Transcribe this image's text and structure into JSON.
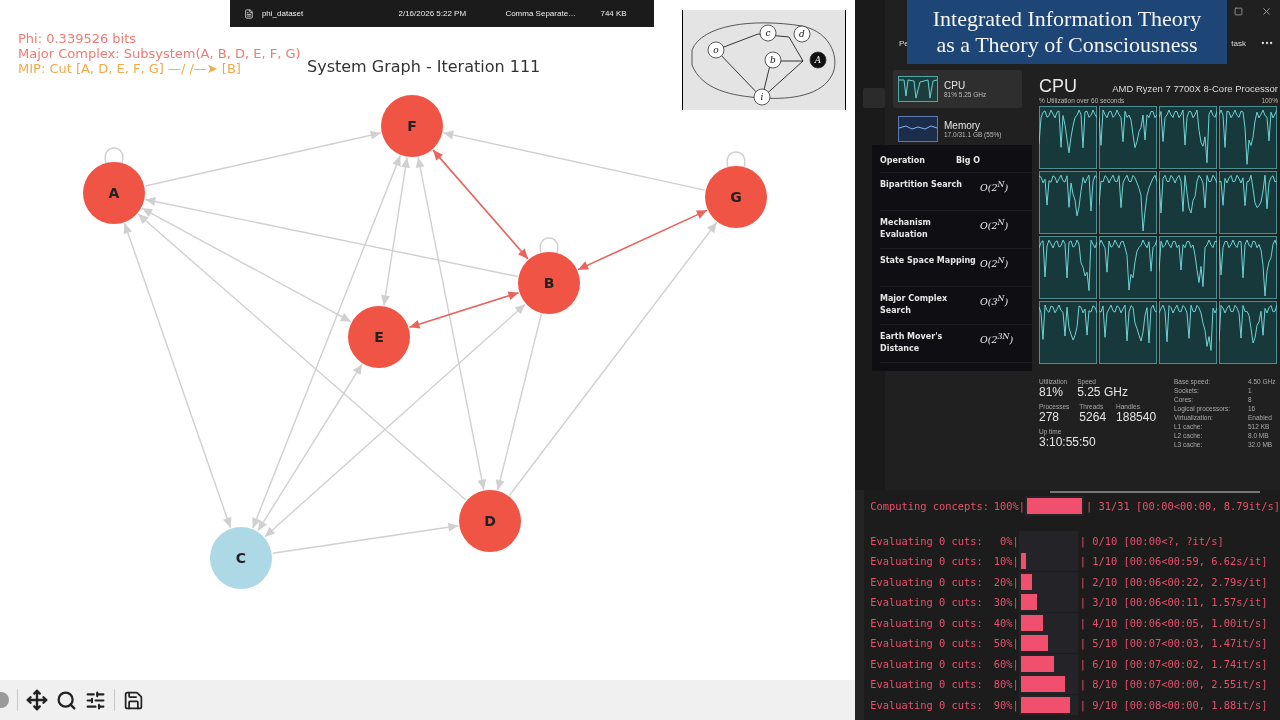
{
  "file_row": {
    "name": "phi_dataset",
    "date": "2/16/2026 5:22 PM",
    "type": "Comma Separate…",
    "size": "744 KB"
  },
  "annotations": [
    {
      "text": "Phi: 0.339526 bits",
      "color": "#ee7b74"
    },
    {
      "text": "Major Complex: Subsystem(A, B, D, E, F, G)",
      "color": "#ee7b74"
    },
    {
      "text": "MIP: Cut [A, D, E, F, G] —/ /—➤ [B]",
      "color": "#f2a948"
    }
  ],
  "graph": {
    "title": "System Graph - Iteration 111",
    "nodes": [
      {
        "label": "A",
        "color": "#f05444"
      },
      {
        "label": "F",
        "color": "#f05444"
      },
      {
        "label": "G",
        "color": "#f05444"
      },
      {
        "label": "B",
        "color": "#f05444"
      },
      {
        "label": "E",
        "color": "#f05444"
      },
      {
        "label": "D",
        "color": "#f05444"
      },
      {
        "label": "C",
        "color": "#add8e6"
      }
    ]
  },
  "inset": {
    "labels": [
      "c",
      "d",
      "o",
      "b",
      "A",
      "i"
    ]
  },
  "title_banner": {
    "lines": [
      "Integrated Information Theory",
      "as a Theory of Consciousness"
    ]
  },
  "task_manager": {
    "header_left": "Pe",
    "header_right": "task",
    "sidebar": [
      {
        "name": "CPU",
        "detail": "81% 5.25 GHz",
        "selected": true
      },
      {
        "name": "Memory",
        "detail": "17.0/31.1 GB (55%)",
        "selected": false
      }
    ],
    "title": "CPU",
    "processor": "AMD Ryzen 7 7700X 8-Core Processor",
    "graph_label": "% Utilization over 60 seconds",
    "graph_max": "100%",
    "stats": [
      [
        {
          "label": "Utilization",
          "value": "81%"
        },
        {
          "label": "Speed",
          "value": "5.25 GHz"
        }
      ],
      [
        {
          "label": "Processes",
          "value": "278"
        },
        {
          "label": "Threads",
          "value": "5264"
        },
        {
          "label": "Handles",
          "value": "188540"
        }
      ],
      [
        {
          "label": "Up time",
          "value": "3:10:55:50"
        }
      ]
    ],
    "specs": [
      {
        "label": "Base speed:",
        "value": "4.50 GHz"
      },
      {
        "label": "Sockets:",
        "value": "1"
      },
      {
        "label": "Cores:",
        "value": "8"
      },
      {
        "label": "Logical processors:",
        "value": "16"
      },
      {
        "label": "Virtualization:",
        "value": "Enabled"
      },
      {
        "label": "L1 cache:",
        "value": "512 KB"
      },
      {
        "label": "L2 cache:",
        "value": "8.0 MB"
      },
      {
        "label": "L3 cache:",
        "value": "32.0 MB"
      }
    ]
  },
  "complexity_table": {
    "columns": [
      "Operation",
      "Big O"
    ],
    "rows": [
      {
        "operation": "Bipartition Search",
        "big_o": "O(2$^{N}$)"
      },
      {
        "operation": "Mechanism Evaluation",
        "big_o": "O(2$^{N}$)"
      },
      {
        "operation": "State Space Mapping",
        "big_o": "O(2$^{N}$)"
      },
      {
        "operation": "Major Complex Search",
        "big_o": "O(3$^{N}$)"
      },
      {
        "operation": "Earth Mover's Distance",
        "big_o": "O(2$^{3N}$)"
      }
    ]
  },
  "terminal": {
    "lines": [
      {
        "label": "Computing concepts:",
        "percent": "100%|",
        "level": 1,
        "stats": "| 31/31 [00:00<00:00,  8.79it/s]"
      },
      {
        "label": "Evaluating 0 cuts:",
        "percent": "0%|",
        "level": 0,
        "stats": "| 0/10 [00:00<?, ?it/s]"
      },
      {
        "label": "Evaluating 0 cuts:",
        "percent": "10%|",
        "level": 0.1,
        "stats": "| 1/10 [00:06<00:59,  6.62s/it]"
      },
      {
        "label": "Evaluating 0 cuts:",
        "percent": "20%|",
        "level": 0.2,
        "stats": "| 2/10 [00:06<00:22,  2.79s/it]"
      },
      {
        "label": "Evaluating 0 cuts:",
        "percent": "30%|",
        "level": 0.3,
        "stats": "| 3/10 [00:06<00:11,  1.57s/it]"
      },
      {
        "label": "Evaluating 0 cuts:",
        "percent": "40%|",
        "level": 0.4,
        "stats": "| 4/10 [00:06<00:05,  1.00it/s]"
      },
      {
        "label": "Evaluating 0 cuts:",
        "percent": "50%|",
        "level": 0.5,
        "stats": "| 5/10 [00:07<00:03,  1.47it/s]"
      },
      {
        "label": "Evaluating 0 cuts:",
        "percent": "60%|",
        "level": 0.6,
        "stats": "| 6/10 [00:07<00:02,  1.74it/s]"
      },
      {
        "label": "Evaluating 0 cuts:",
        "percent": "80%|",
        "level": 0.8,
        "stats": "| 8/10 [00:07<00:00,  2.55it/s]"
      },
      {
        "label": "Evaluating 0 cuts:",
        "percent": "90%|",
        "level": 0.9,
        "stats": "| 9/10 [00:08<00:00,  1.88it/s]"
      }
    ]
  }
}
